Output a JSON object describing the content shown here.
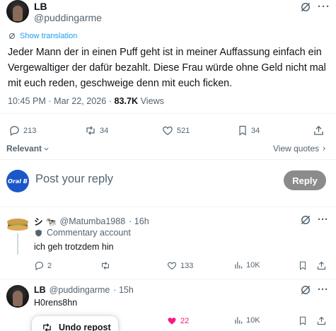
{
  "main_tweet": {
    "author_name": "LB",
    "author_handle": "@puddingarme",
    "show_translation": "Show translation",
    "text": "Jeder Mann der in einen Puff geht ist in meiner Auffassung einfach ein Vergewaltiger der dafür bezahlt. Diese Frau würde ohne Geld nicht mal mit euch reden, geschweige denn mit euch ficken.",
    "time": "10:45 PM · Mar 22, 2026 · ",
    "views_count": "83.7K",
    "views_label": " Views",
    "actions": {
      "replies": "213",
      "reposts": "34",
      "likes": "521",
      "bookmarks": "34"
    },
    "more_icon": "more-dots-icon",
    "grok_icon": "grok-icon"
  },
  "sort": {
    "relevant_label": "Relevant",
    "view_quotes_label": "View quotes"
  },
  "composer": {
    "avatar_text": "Oral B",
    "placeholder": "Post your reply",
    "reply_button": "Reply"
  },
  "replies": [
    {
      "name_emoji": "シ 🐄",
      "handle": "@Matumba1988",
      "time": "· 16h",
      "badge": "Commentary account",
      "text": "ich geh trotzdem hin",
      "actions": {
        "replies": "2",
        "reposts": "",
        "likes": "133",
        "views": "10K"
      }
    },
    {
      "name": "LB",
      "handle": "@puddingarme",
      "time": "· 15h",
      "text": "H0rens8hn",
      "actions": {
        "likes": "22",
        "views": "10K"
      }
    }
  ],
  "toast": {
    "label": "Undo repost"
  },
  "colors": {
    "accent": "#1d9bf0",
    "liked": "#f91880",
    "muted": "#536471",
    "reply_button_bg": "#8b8b8b",
    "divider": "#eff3f4"
  }
}
